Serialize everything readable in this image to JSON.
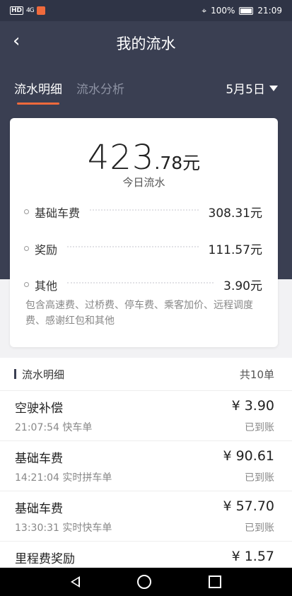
{
  "status": {
    "battery": "100%",
    "time": "21:09",
    "hd": "HD",
    "signal": "4G"
  },
  "header": {
    "title": "我的流水",
    "back_glyph": "‹"
  },
  "tabs": [
    {
      "label": "流水明细"
    },
    {
      "label": "流水分析"
    }
  ],
  "date": {
    "label": "5月5日"
  },
  "summary": {
    "total_int": "423",
    "total_dec": ".78元",
    "total_label": "今日流水",
    "rows": [
      {
        "label": "基础车费",
        "amount": "308.31元"
      },
      {
        "label": "奖励",
        "amount": "111.57元"
      },
      {
        "label": "其他",
        "amount": "3.90元"
      }
    ],
    "note": "包含高速费、过桥费、停车费、乘客加价、远程调度费、感谢红包和其他"
  },
  "list": {
    "title": "流水明细",
    "count": "共10单",
    "items": [
      {
        "title": "空驶补偿",
        "sub": "21:07:54 快车单",
        "amount": "¥ 3.90",
        "status": "已到账"
      },
      {
        "title": "基础车费",
        "sub": "14:21:04 实时拼车单",
        "amount": "¥ 90.61",
        "status": "已到账"
      },
      {
        "title": "基础车费",
        "sub": "13:30:31 实时快车单",
        "amount": "¥ 57.70",
        "status": "已到账"
      },
      {
        "title": "里程费奖励",
        "sub": "",
        "amount": "¥ 1.57",
        "status": ""
      }
    ]
  },
  "colors": {
    "header_bg": "#3a3f52",
    "accent": "#f06a3c"
  }
}
